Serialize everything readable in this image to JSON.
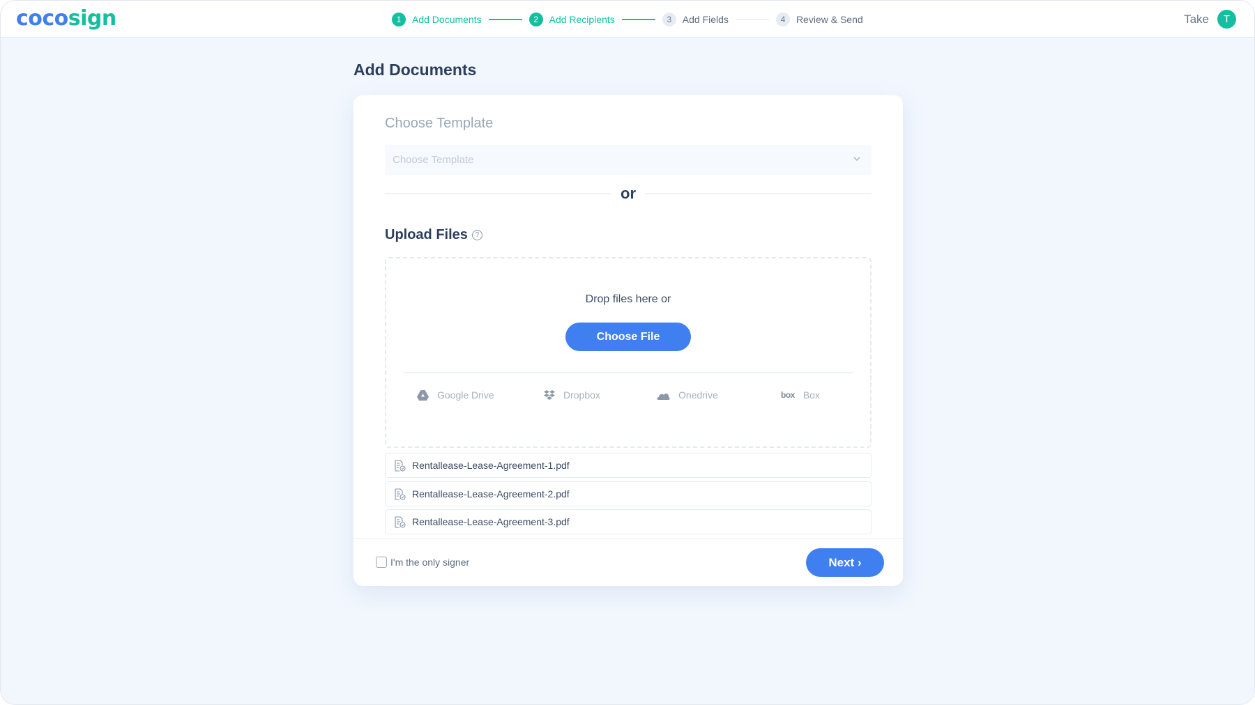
{
  "brand": {
    "part1": "coco",
    "part2": "sign"
  },
  "stepper": {
    "steps": [
      {
        "number": "1",
        "label": "Add Documents",
        "state": "done"
      },
      {
        "number": "2",
        "label": "Add Recipients",
        "state": "done"
      },
      {
        "number": "3",
        "label": "Add Fields",
        "state": "todo"
      },
      {
        "number": "4",
        "label": "Review & Send",
        "state": "todo"
      }
    ]
  },
  "user": {
    "name": "Take",
    "avatar_initial": "T"
  },
  "page": {
    "title": "Add Documents"
  },
  "template": {
    "label": "Choose Template",
    "placeholder": "Choose Template",
    "chevron_icon": "chevron-down-icon"
  },
  "divider_text": "or",
  "upload": {
    "title": "Upload Files",
    "help_icon": "?",
    "drop_text": "Drop files here or",
    "choose_button": "Choose File",
    "providers": [
      {
        "name": "Google Drive",
        "icon": "google-drive-icon"
      },
      {
        "name": "Dropbox",
        "icon": "dropbox-icon"
      },
      {
        "name": "Onedrive",
        "icon": "onedrive-icon"
      },
      {
        "name": "Box",
        "icon": "box-icon",
        "icon_text": "box"
      }
    ]
  },
  "files": [
    {
      "name": "Rentallease-Lease-Agreement-1.pdf"
    },
    {
      "name": "Rentallease-Lease-Agreement-2.pdf"
    },
    {
      "name": "Rentallease-Lease-Agreement-3.pdf"
    }
  ],
  "footer": {
    "only_signer_label": "I'm the only signer",
    "only_signer_checked": false,
    "next_button": "Next ›"
  },
  "colors": {
    "primary": "#3f7ff0",
    "accent": "#14bfa0",
    "background": "#f2f7fe"
  }
}
